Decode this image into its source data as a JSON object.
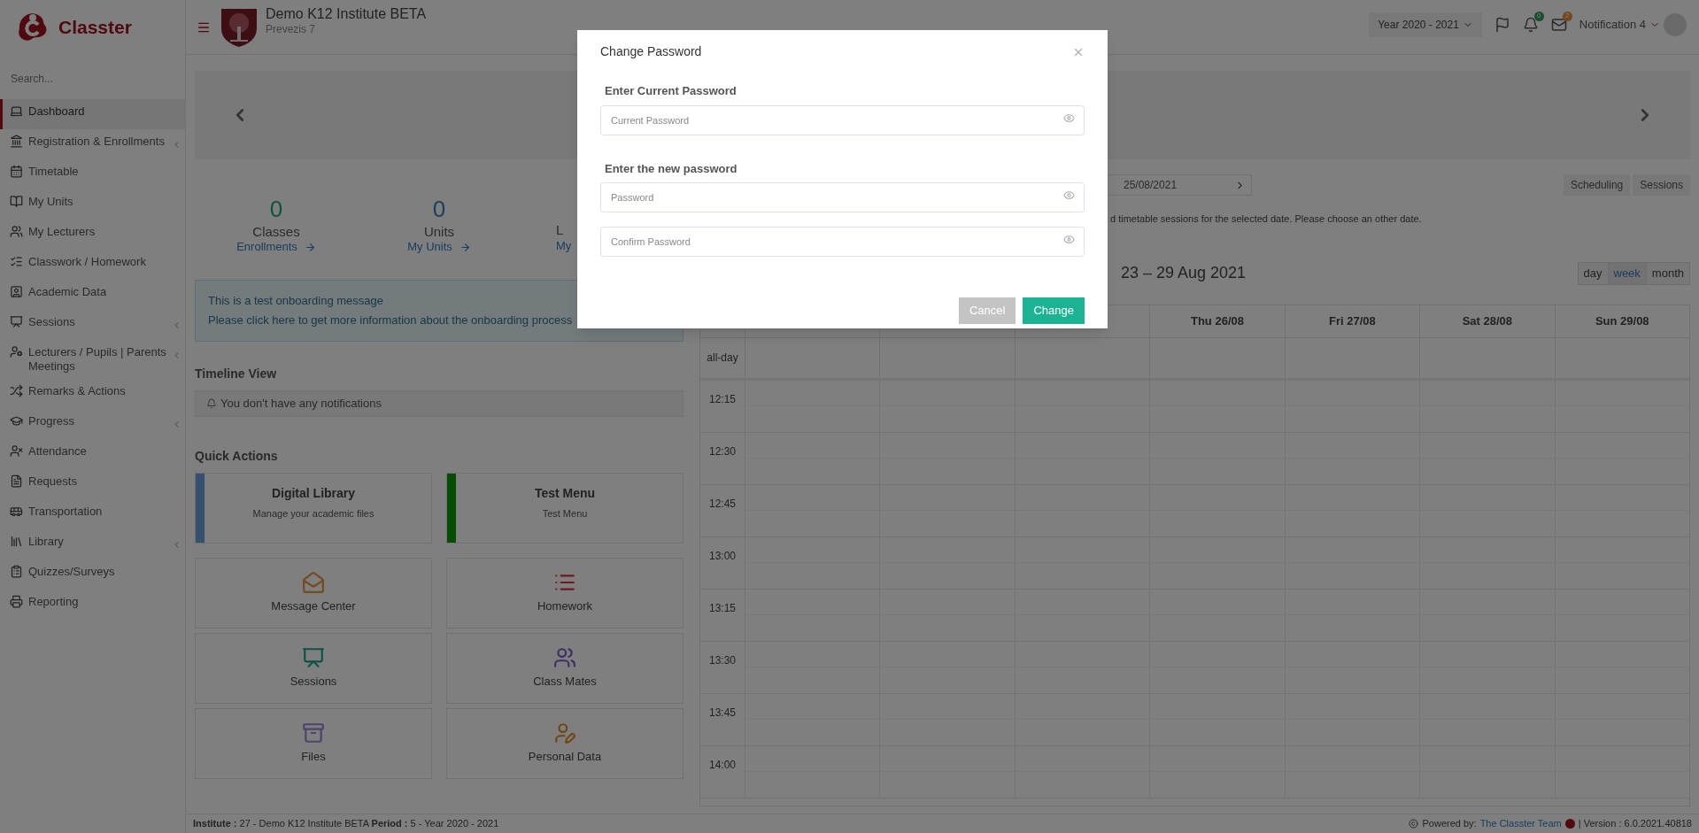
{
  "sidebar": {
    "brand": "Classter",
    "search": {
      "placeholder": "Search..."
    },
    "items": [
      {
        "label": "Dashboard",
        "selected": true,
        "expandable": false
      },
      {
        "label": "Registration & Enrollments",
        "selected": false,
        "expandable": true
      },
      {
        "label": "Timetable",
        "selected": false,
        "expandable": false
      },
      {
        "label": "My Units",
        "selected": false,
        "expandable": false
      },
      {
        "label": "My Lecturers",
        "selected": false,
        "expandable": false
      },
      {
        "label": "Classwork / Homework",
        "selected": false,
        "expandable": false
      },
      {
        "label": "Academic Data",
        "selected": false,
        "expandable": false
      },
      {
        "label": "Sessions",
        "selected": false,
        "expandable": true
      },
      {
        "label": "Lecturers / Pupils | Parents Meetings",
        "selected": false,
        "expandable": true
      },
      {
        "label": "Remarks & Actions",
        "selected": false,
        "expandable": false
      },
      {
        "label": "Progress",
        "selected": false,
        "expandable": true
      },
      {
        "label": "Attendance",
        "selected": false,
        "expandable": false
      },
      {
        "label": "Requests",
        "selected": false,
        "expandable": false
      },
      {
        "label": "Transportation",
        "selected": false,
        "expandable": false
      },
      {
        "label": "Library",
        "selected": false,
        "expandable": true
      },
      {
        "label": "Quizzes/Surveys",
        "selected": false,
        "expandable": false
      },
      {
        "label": "Reporting",
        "selected": false,
        "expandable": false
      }
    ]
  },
  "header": {
    "title": "Demo K12 Institute BETA",
    "subtitle": "Prevezis 7",
    "year": "Year 2020 - 2021",
    "badges": [
      {
        "count": "0",
        "color": "#174f2e"
      },
      {
        "count": "2",
        "color": "#74491d"
      }
    ],
    "user": "Notification 4"
  },
  "stats": [
    {
      "value": "0",
      "label": "Classes",
      "link": "Enrollments",
      "color": "#10533d"
    },
    {
      "value": "0",
      "label": "Units",
      "link": "My Units",
      "color": "#1a3d5c"
    },
    {
      "label": "L",
      "link": "My"
    }
  ],
  "onboarding": {
    "message": "This is a test onboarding message",
    "link": "Please click here to get more information about the onboarding process"
  },
  "timeline": {
    "title": "Timeline View",
    "empty": "You don't have any notifications"
  },
  "quick_actions": {
    "title": "Quick Actions",
    "items": [
      {
        "kind": "banner",
        "title": "Digital Library",
        "subtitle": "Manage your academic files",
        "color": "#385070"
      },
      {
        "kind": "banner",
        "title": "Test Menu",
        "subtitle": "Test Menu",
        "color": "#054d05"
      },
      {
        "kind": "tile",
        "label": "Message Center",
        "color": "#744b1e"
      },
      {
        "kind": "tile",
        "label": "Homework",
        "color": "#6d1a1e"
      },
      {
        "kind": "tile",
        "label": "Sessions",
        "color": "#0d5345"
      },
      {
        "kind": "tile",
        "label": "Class Mates",
        "color": "#3e3065"
      },
      {
        "kind": "tile",
        "label": "Files",
        "color": "#4d436b"
      },
      {
        "kind": "tile",
        "label": "Personal Data",
        "color": "#704517"
      }
    ]
  },
  "calendar": {
    "date": "25/08/2021",
    "modes": [
      {
        "label": "Scheduling"
      },
      {
        "label": "Sessions"
      }
    ],
    "message": "d timetable sessions for the selected date. Please choose an other date.",
    "title": "23 – 29 Aug 2021",
    "views": [
      {
        "label": "day",
        "selected": false
      },
      {
        "label": "week",
        "selected": true
      },
      {
        "label": "month",
        "selected": false
      }
    ],
    "columns": [
      {
        "kind": "covered"
      },
      {
        "kind": "covered"
      },
      {
        "kind": "covered"
      },
      {
        "kind": "day",
        "label": "Thu 26/08"
      },
      {
        "kind": "day",
        "label": "Fri 27/08"
      },
      {
        "kind": "day",
        "label": "Sat 28/08"
      },
      {
        "kind": "day",
        "label": "Sun 29/08"
      }
    ],
    "all_day": "all-day",
    "times": [
      "12:15",
      "12:30",
      "12:45",
      "13:00",
      "13:15",
      "13:30",
      "13:45",
      "14:00"
    ]
  },
  "footer": {
    "info": "**Institute :** 27 - Demo K12 Institute BETA **Period :** 5 - Year 2020 - 2021",
    "powered": "Powered by:",
    "team": "The Classter Team",
    "version": "| Version : 6.0.2021.40818"
  },
  "modal": {
    "title": "Change Password",
    "fields": [
      {
        "label": "Enter Current Password",
        "placeholder": "Current Password"
      },
      {
        "label": "Enter the new password",
        "placeholder": "Password"
      },
      {
        "placeholder": "Confirm Password"
      }
    ],
    "buttons": [
      {
        "kind": "cancel",
        "label": "Cancel"
      },
      {
        "kind": "primary",
        "label": "Change"
      }
    ]
  }
}
